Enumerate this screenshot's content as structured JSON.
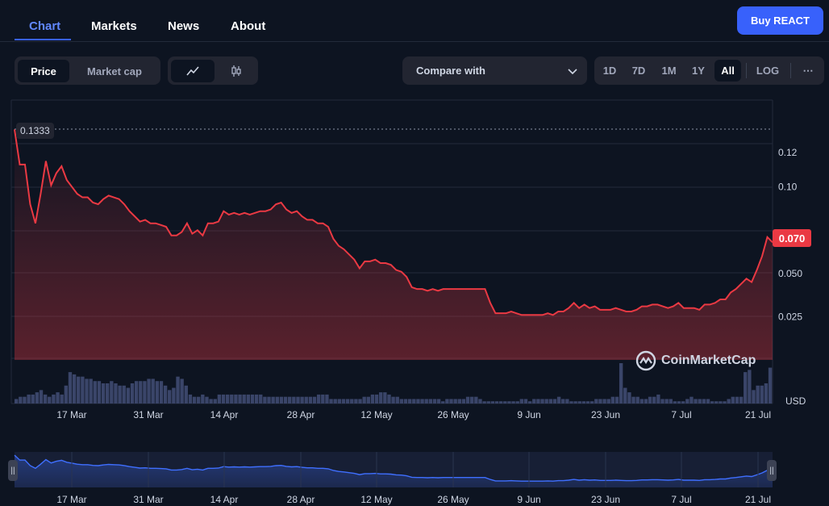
{
  "tabs": [
    {
      "label": "Chart",
      "active": true
    },
    {
      "label": "Markets",
      "active": false
    },
    {
      "label": "News",
      "active": false
    },
    {
      "label": "About",
      "active": false
    }
  ],
  "buy_button": "Buy REACT",
  "metric_toggle": {
    "options": [
      "Price",
      "Market cap"
    ],
    "selected": "Price"
  },
  "chart_style_toggle": {
    "options": [
      "line-chart-icon",
      "candlestick-icon"
    ],
    "selected": "line-chart-icon"
  },
  "compare": {
    "label": "Compare with",
    "icon": "chevron-down-icon"
  },
  "ranges": {
    "options": [
      "1D",
      "7D",
      "1M",
      "1Y",
      "All"
    ],
    "selected": "All",
    "log": "LOG",
    "more": "⋯"
  },
  "watermark": "CoinMarketCap",
  "quote_currency": "USD",
  "price_high_label": "0.1333",
  "current_price_label": "0.070",
  "colors": {
    "line": "#ea3943",
    "accent": "#3861fb",
    "volume": "#3a4569",
    "navigator_line": "#3f6fff"
  },
  "chart_data": {
    "type": "line",
    "ylabel": "",
    "yticks": [
      0.025,
      0.05,
      0.1,
      0.12
    ],
    "ytick_labels": [
      "0.025",
      "0.050",
      "0.10",
      "0.12"
    ],
    "ylim": [
      0.0,
      0.15
    ],
    "xtick_labels": [
      "17 Mar",
      "31 Mar",
      "14 Apr",
      "28 Apr",
      "12 May",
      "26 May",
      "9 Jun",
      "23 Jun",
      "7 Jul",
      "21 Jul"
    ],
    "x_start": "2024-03-07",
    "x_end": "2024-07-22",
    "price_series": {
      "name": "Price",
      "values": [
        0.1333,
        0.113,
        0.113,
        0.09,
        0.079,
        0.096,
        0.115,
        0.101,
        0.108,
        0.112,
        0.104,
        0.1,
        0.096,
        0.094,
        0.094,
        0.091,
        0.09,
        0.093,
        0.095,
        0.094,
        0.093,
        0.09,
        0.086,
        0.083,
        0.08,
        0.081,
        0.079,
        0.079,
        0.078,
        0.077,
        0.072,
        0.072,
        0.074,
        0.079,
        0.073,
        0.075,
        0.072,
        0.079,
        0.079,
        0.08,
        0.086,
        0.084,
        0.085,
        0.084,
        0.085,
        0.084,
        0.085,
        0.086,
        0.086,
        0.087,
        0.09,
        0.091,
        0.087,
        0.085,
        0.086,
        0.083,
        0.081,
        0.081,
        0.079,
        0.079,
        0.077,
        0.07,
        0.066,
        0.064,
        0.061,
        0.058,
        0.053,
        0.057,
        0.057,
        0.058,
        0.056,
        0.056,
        0.055,
        0.052,
        0.051,
        0.048,
        0.042,
        0.041,
        0.041,
        0.04,
        0.041,
        0.04,
        0.041,
        0.041,
        0.041,
        0.041,
        0.041,
        0.041,
        0.041,
        0.041,
        0.041,
        0.033,
        0.027,
        0.027,
        0.027,
        0.028,
        0.027,
        0.026,
        0.026,
        0.026,
        0.026,
        0.026,
        0.027,
        0.026,
        0.028,
        0.028,
        0.03,
        0.033,
        0.03,
        0.032,
        0.03,
        0.031,
        0.029,
        0.029,
        0.029,
        0.03,
        0.029,
        0.028,
        0.028,
        0.029,
        0.031,
        0.031,
        0.032,
        0.032,
        0.031,
        0.03,
        0.031,
        0.033,
        0.03,
        0.03,
        0.03,
        0.029,
        0.032,
        0.032,
        0.033,
        0.035,
        0.035,
        0.039,
        0.041,
        0.044,
        0.047,
        0.045,
        0.052,
        0.06,
        0.071,
        0.068
      ]
    },
    "volume_series": {
      "name": "Volume",
      "values": [
        2,
        3,
        3,
        4,
        4,
        5,
        6,
        4,
        3,
        4,
        5,
        4,
        8,
        14,
        13,
        12,
        12,
        11,
        11,
        10,
        10,
        9,
        9,
        10,
        9,
        8,
        8,
        7,
        9,
        10,
        10,
        10,
        11,
        11,
        10,
        10,
        8,
        6,
        7,
        12,
        11,
        8,
        4,
        3,
        3,
        4,
        3,
        2,
        2,
        4,
        4,
        4,
        4,
        4,
        4,
        4,
        4,
        4,
        4,
        4,
        3,
        3,
        3,
        3,
        3,
        3,
        3,
        3,
        3,
        3,
        3,
        3,
        3,
        4,
        4,
        4,
        2,
        2,
        2,
        2,
        2,
        2,
        2,
        2,
        3,
        3,
        4,
        4,
        5,
        5,
        4,
        3,
        3,
        2,
        2,
        2,
        2,
        2,
        2,
        2,
        2,
        2,
        2,
        1,
        2,
        2,
        2,
        2,
        2,
        3,
        3,
        3,
        2,
        1,
        1,
        1,
        1,
        1,
        1,
        1,
        1,
        1,
        2,
        2,
        1,
        2,
        2,
        2,
        2,
        2,
        2,
        3,
        2,
        2,
        1,
        1,
        1,
        1,
        1,
        1,
        2,
        2,
        2,
        2,
        3,
        3,
        18,
        7,
        5,
        3,
        3,
        2,
        2,
        3,
        3,
        4,
        2,
        2,
        2,
        1,
        1,
        1,
        2,
        3,
        2,
        2,
        2,
        2,
        1,
        1,
        1,
        1,
        2,
        3,
        3,
        3,
        14,
        15,
        6,
        8,
        8,
        9,
        16
      ]
    }
  }
}
